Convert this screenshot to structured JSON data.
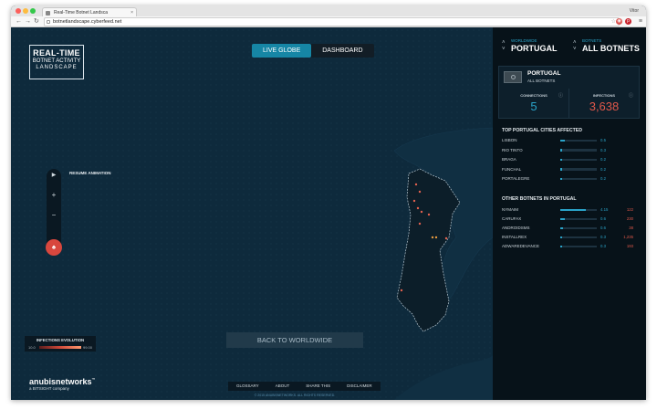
{
  "browser": {
    "tab_title": "Real-Time Botnet Landsca",
    "tab_close": "×",
    "user": "Vitor",
    "url": "botnetlandscape.cyberfeed.net",
    "back": "←",
    "forward": "→",
    "reload": "↻",
    "star": "☆",
    "menu": "≡",
    "extensions": [
      {
        "name": "extension-adblock-icon",
        "color": "#d9534f",
        "glyph": "◉"
      },
      {
        "name": "extension-pinterest-icon",
        "color": "#c8232c",
        "glyph": "p"
      }
    ]
  },
  "logo": {
    "line1": "REAL-TIME",
    "line2": "BOTNET ACTIVITY",
    "line3": "LANDSCAPE"
  },
  "view_toggle": {
    "live_globe": "LIVE GLOBE",
    "dashboard": "DASHBOARD"
  },
  "controls": {
    "play": "▶",
    "zoom_in": "+",
    "zoom_out": "−",
    "resume": "RESUME ANIMATION",
    "home": "♠"
  },
  "legend": {
    "title": "INFECTIONS EVOLUTION",
    "min": "10.0",
    "max": "99.00"
  },
  "back_button": "BACK TO WORLDWIDE",
  "brand": {
    "name": "anubisnetworks",
    "tm": "™",
    "sub": "a BITSIGHT company"
  },
  "footer": {
    "links": [
      "GLOSSARY",
      "ABOUT",
      "SHARE THIS",
      "DISCLAIMER"
    ],
    "copyright": "© 2015 ANUBISNETWORKS. ALL RIGHTS RESERVED."
  },
  "sidebar": {
    "worldwide": {
      "label": "WORLDWIDE",
      "value": "PORTUGAL"
    },
    "botnets": {
      "label": "BOTNETS",
      "value": "ALL BOTNETS"
    },
    "country": {
      "name": "PORTUGAL",
      "sub": "ALL BOTNETS",
      "connections_label": "CONNECTIONS",
      "connections_value": "5",
      "infections_label": "INFECTIONS",
      "infections_value": "3,638",
      "info_icon": "ⓘ"
    },
    "cities_title": "TOP PORTUGAL CITIES AFFECTED",
    "cities": [
      {
        "name": "LISBON",
        "pct": "0.5",
        "fill": 0.12
      },
      {
        "name": "RIO TINTO",
        "pct": "0.3",
        "fill": 0.06
      },
      {
        "name": "BRAGA",
        "pct": "0.2",
        "fill": 0.05
      },
      {
        "name": "FUNCHAL",
        "pct": "0.2",
        "fill": 0.05
      },
      {
        "name": "PORTALEGRE",
        "pct": "0.2",
        "fill": 0.05
      }
    ],
    "botnets_title": "OTHER BOTNETS IN PORTUGAL",
    "botnets_list": [
      {
        "name": "NYMAIM",
        "pct": "4.15",
        "count": "122",
        "fill": 0.7
      },
      {
        "name": "CARUFAX",
        "pct": "0.6",
        "count": "230",
        "fill": 0.12
      },
      {
        "name": "ANDROIDSMS",
        "pct": "0.6",
        "count": "38",
        "fill": 0.08
      },
      {
        "name": "INSTALLREX",
        "pct": "0.3",
        "count": "1,235",
        "fill": 0.05
      },
      {
        "name": "ADWAREDEVANCE",
        "pct": "0.3",
        "count": "193",
        "fill": 0.05
      }
    ]
  },
  "colors": {
    "accent": "#2aa3c8",
    "danger": "#e0584a",
    "map_bg": "#0e2a3c",
    "sidebar_bg": "#071219"
  }
}
